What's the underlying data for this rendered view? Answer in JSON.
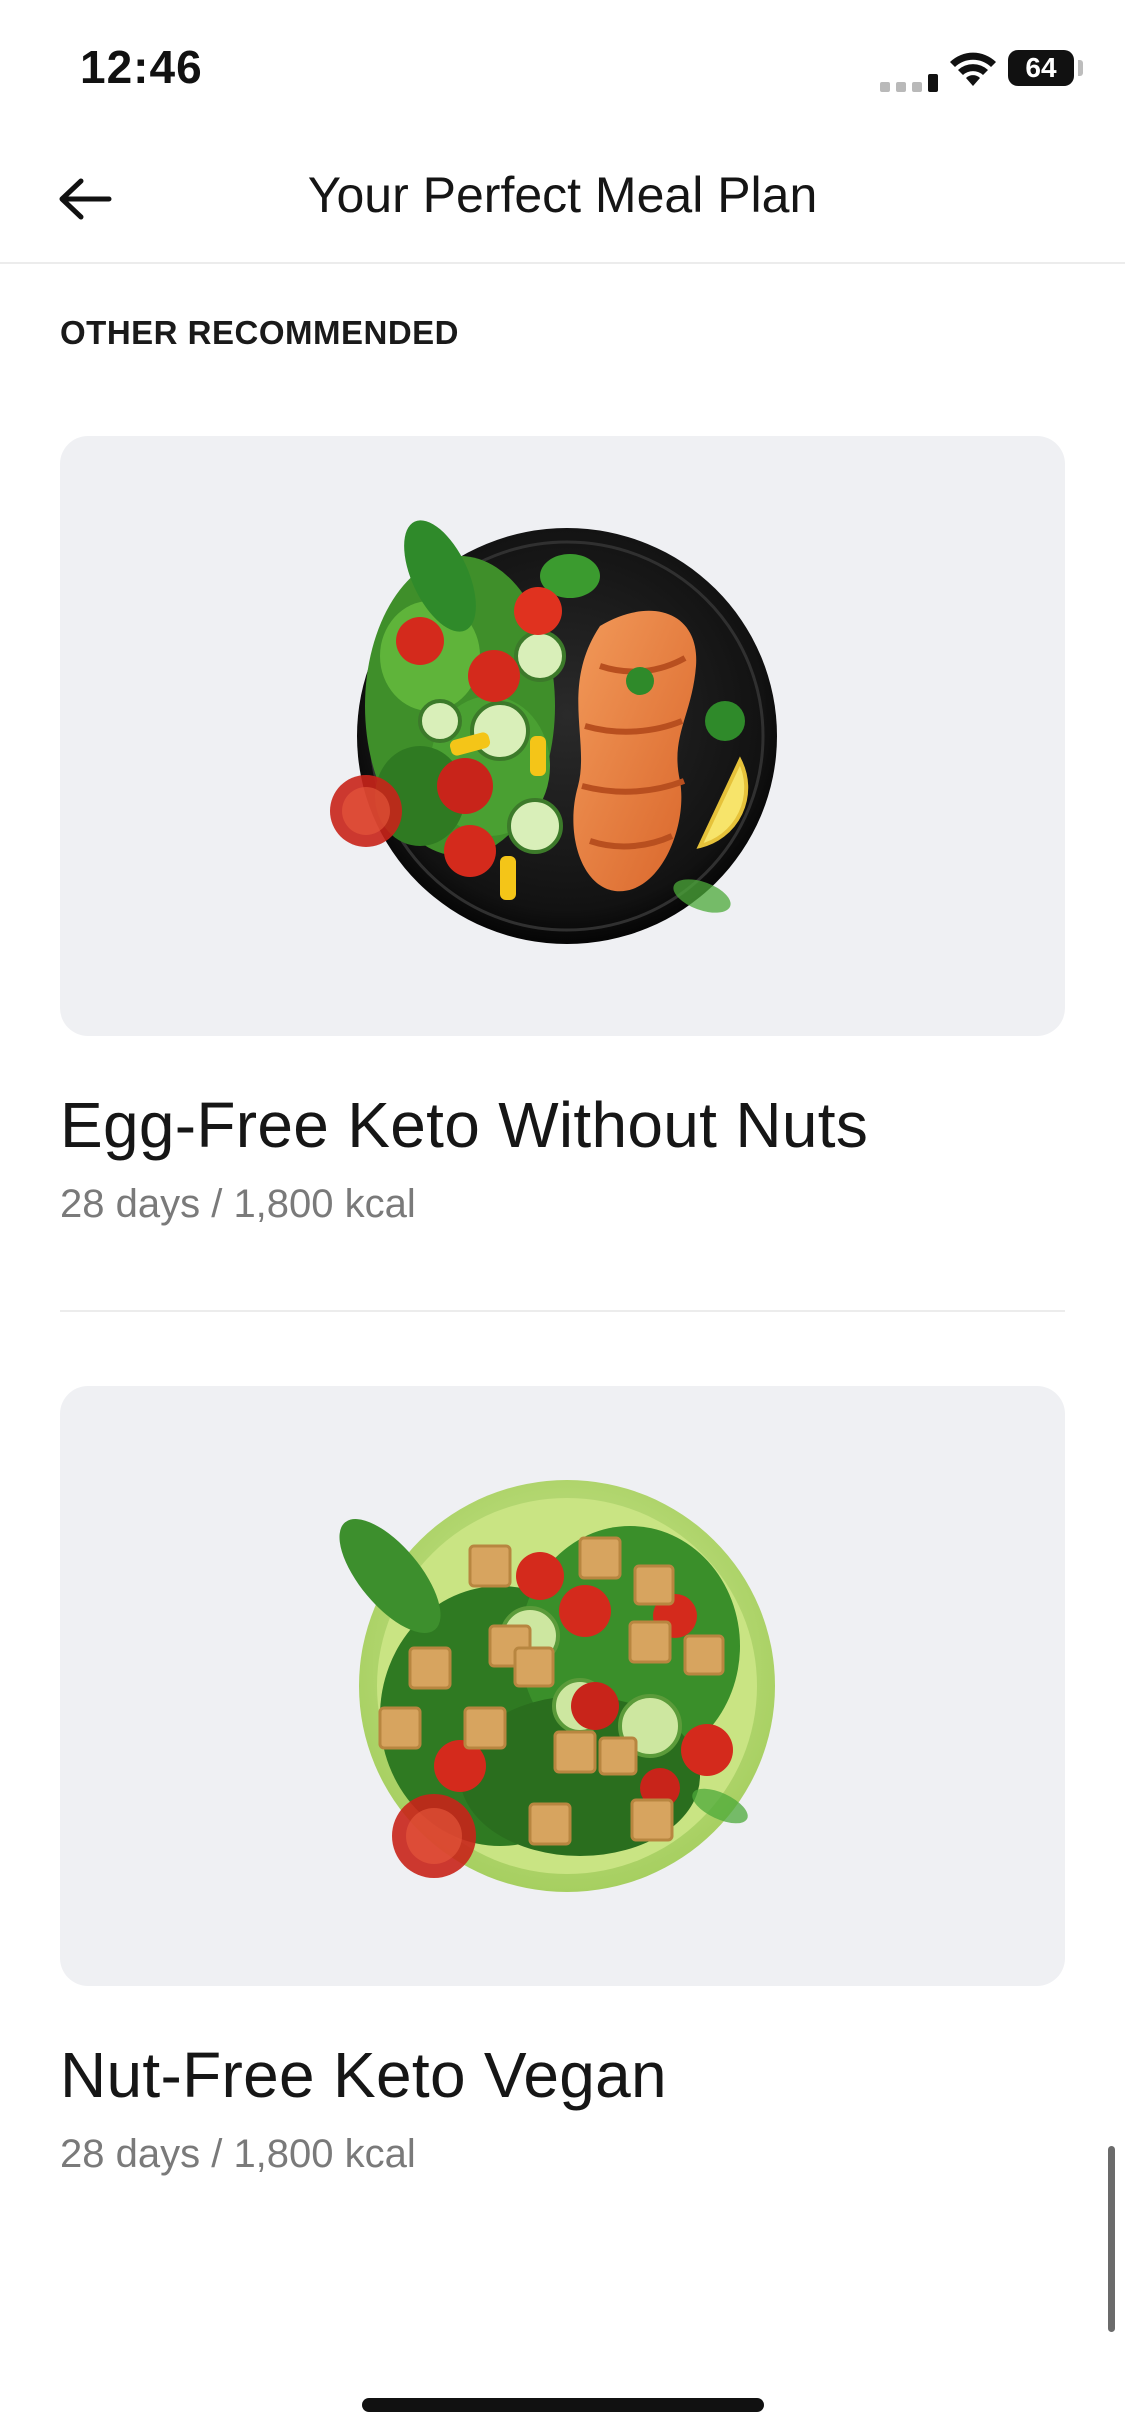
{
  "status_bar": {
    "time": "12:46",
    "battery": "64"
  },
  "header": {
    "title": "Your Perfect Meal Plan",
    "back_icon": "arrow-left-icon"
  },
  "section": {
    "heading": "OTHER RECOMMENDED"
  },
  "plans": [
    {
      "title": "Egg-Free Keto Without Nuts",
      "subtitle": "28 days / 1,800 kcal",
      "image": "salmon-salad-plate"
    },
    {
      "title": "Nut-Free Keto Vegan",
      "subtitle": "28 days / 1,800 kcal",
      "image": "tofu-spinach-bowl"
    }
  ],
  "colors": {
    "card_bg": "#eff0f3",
    "text_primary": "#161616",
    "text_secondary": "#7a7a7a"
  }
}
